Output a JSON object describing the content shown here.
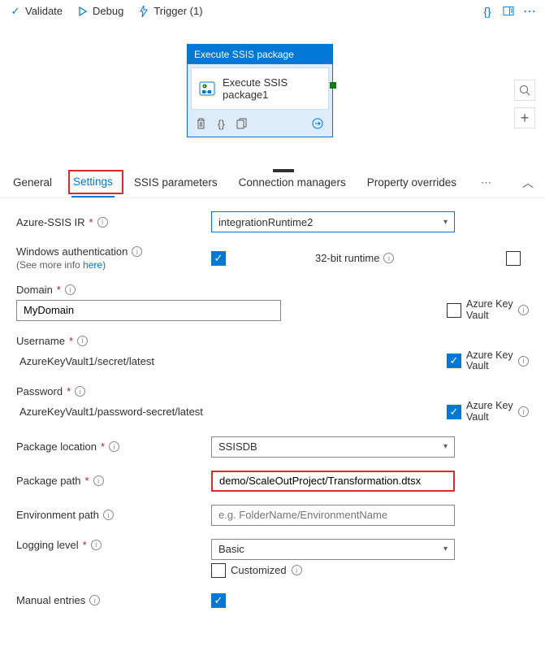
{
  "toolbar": {
    "validate": "Validate",
    "debug": "Debug",
    "trigger": "Trigger (1)"
  },
  "activity": {
    "header": "Execute SSIS package",
    "title": "Execute SSIS package1"
  },
  "tabs": {
    "general": "General",
    "settings": "Settings",
    "ssis_params": "SSIS parameters",
    "conn_mgrs": "Connection managers",
    "prop_overrides": "Property overrides"
  },
  "form": {
    "azure_ssis_ir_label": "Azure-SSIS IR",
    "azure_ssis_ir_value": "integrationRuntime2",
    "win_auth_label": "Windows authentication",
    "win_auth_sub_pre": "(See more info ",
    "win_auth_sub_link": "here",
    "win_auth_sub_post": ")",
    "runtime32_label": "32-bit runtime",
    "domain_label": "Domain",
    "domain_value": "MyDomain",
    "akv_label": "Azure Key Vault",
    "username_label": "Username",
    "username_value": "AzureKeyVault1/secret/latest",
    "password_label": "Password",
    "password_value": "AzureKeyVault1/password-secret/latest",
    "pkg_loc_label": "Package location",
    "pkg_loc_value": "SSISDB",
    "pkg_path_label": "Package path",
    "pkg_path_value": "demo/ScaleOutProject/Transformation.dtsx",
    "env_path_label": "Environment path",
    "env_path_placeholder": "e.g. FolderName/EnvironmentName",
    "log_level_label": "Logging level",
    "log_level_value": "Basic",
    "customized_label": "Customized",
    "manual_entries_label": "Manual entries"
  }
}
